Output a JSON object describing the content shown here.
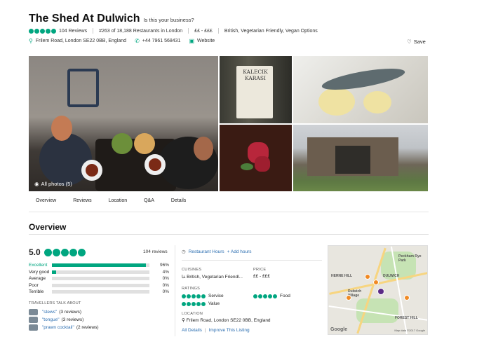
{
  "header": {
    "name": "The Shed At Dulwich",
    "claim": "Is this your business?",
    "reviews": "104 Reviews",
    "rank": "#263 of 18,188 Restaurants in London",
    "price": "££ - £££",
    "cuisines": "British, Vegetarian Friendly, Vegan Options",
    "address": "Frilem Road, London SE22 0BB, England",
    "phone": "+44 7961 568431",
    "website": "Website",
    "save": "Save"
  },
  "photos": {
    "all_photos": "All photos (5)",
    "bottle_text": "KALECIK KARASI"
  },
  "tabs": [
    "Overview",
    "Reviews",
    "Location",
    "Q&A",
    "Details"
  ],
  "overview": {
    "title": "Overview",
    "score": "5.0",
    "review_count": "104 reviews",
    "rating_rows": [
      {
        "label": "Excellent",
        "pct": "96%",
        "fill": 0.96
      },
      {
        "label": "Very good",
        "pct": "4%",
        "fill": 0.04
      },
      {
        "label": "Average",
        "pct": "0%",
        "fill": 0
      },
      {
        "label": "Poor",
        "pct": "0%",
        "fill": 0
      },
      {
        "label": "Terrible",
        "pct": "0%",
        "fill": 0
      }
    ],
    "travellers_head": "TRAVELLERS TALK ABOUT",
    "topics": [
      {
        "quote": "\"stews\"",
        "count": "(3 reviews)"
      },
      {
        "quote": "\"tongue\"",
        "count": "(3 reviews)"
      },
      {
        "quote": "\"prawn cocktail\"",
        "count": "(2 reviews)"
      }
    ]
  },
  "details": {
    "hours": "Restaurant Hours",
    "add_hours": "+ Add hours",
    "cuisines_head": "CUISINES",
    "cuisines_val": "British, Vegetarian Friendl...",
    "price_head": "PRICE",
    "price_val": "££ - £££",
    "ratings_head": "RATINGS",
    "service": "Service",
    "food": "Food",
    "value": "Value",
    "location_head": "LOCATION",
    "location_val": "Frilem Road, London SE22 0BB, England",
    "all_details": "All Details",
    "improve": "Improve This Listing"
  },
  "map": {
    "labels": [
      "Peckham Rye Park",
      "HERNE HILL",
      "Dulwich Village",
      "DULWICH",
      "FOREST HILL"
    ],
    "google": "Google",
    "copyright": "Map data ©2017 Google"
  },
  "colors": {
    "accent": "#00a680",
    "link": "#2a6db0"
  }
}
